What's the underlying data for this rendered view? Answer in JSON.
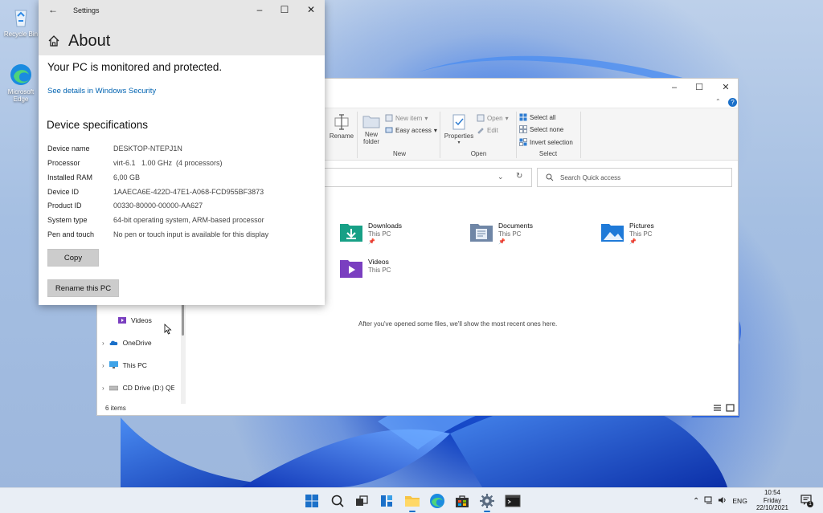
{
  "desktop": {
    "icons": [
      {
        "label": "Recycle Bin"
      },
      {
        "label": "Microsoft Edge"
      }
    ]
  },
  "settings": {
    "window_title": "Settings",
    "page_title": "About",
    "protection_status": "Your PC is monitored and protected.",
    "security_link": "See details in Windows Security",
    "specs_heading": "Device specifications",
    "specs": [
      {
        "key": "Device name",
        "value": "DESKTOP-NTEPJ1N"
      },
      {
        "key": "Processor",
        "value": "virt-6.1   1.00 GHz  (4 processors)"
      },
      {
        "key": "Installed RAM",
        "value": "6,00 GB"
      },
      {
        "key": "Device ID",
        "value": "1AAECA6E-422D-47E1-A068-FCD955BF3873"
      },
      {
        "key": "Product ID",
        "value": "00330-80000-00000-AA627"
      },
      {
        "key": "System type",
        "value": "64-bit operating system, ARM-based processor"
      },
      {
        "key": "Pen and touch",
        "value": "No pen or touch input is available for this display"
      }
    ],
    "copy_button": "Copy",
    "rename_button": "Rename this PC"
  },
  "explorer": {
    "ribbon": {
      "rename": "Rename",
      "new_folder": "New folder",
      "new_item": "New item",
      "easy_access": "Easy access",
      "new_group": "New",
      "properties": "Properties",
      "open": "Open",
      "edit": "Edit",
      "open_group": "Open",
      "select_all": "Select all",
      "select_none": "Select none",
      "invert_selection": "Invert selection",
      "select_group": "Select"
    },
    "search_placeholder": "Search Quick access",
    "folders": [
      {
        "name": "Downloads",
        "location": "This PC"
      },
      {
        "name": "Documents",
        "location": "This PC"
      },
      {
        "name": "Pictures",
        "location": "This PC"
      },
      {
        "name": "Videos",
        "location": "This PC"
      }
    ],
    "nav": [
      {
        "label": "Videos"
      },
      {
        "label": "OneDrive"
      },
      {
        "label": "This PC"
      },
      {
        "label": "CD Drive (D:) QEM"
      }
    ],
    "recent_message": "After you've opened some files, we'll show the most recent ones here.",
    "status": "6 items"
  },
  "taskbar": {
    "language": "ENG",
    "time": "10:54",
    "day": "Friday",
    "date": "22/10/2021",
    "notification_count": "1"
  },
  "colors": {
    "accent": "#0063b1",
    "taskbar": "#e9eef5",
    "settings_header": "#e6e6e6"
  }
}
